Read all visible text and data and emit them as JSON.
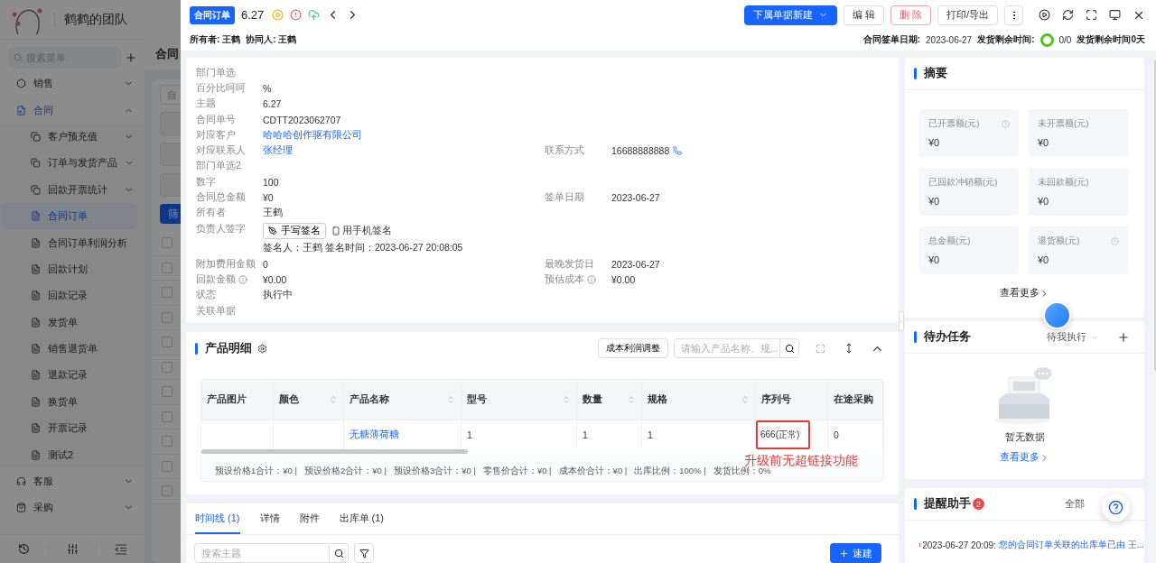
{
  "background_page": {
    "team_name": "鹤鹤的团队",
    "search": {
      "placeholder": "搜索菜单"
    },
    "menu": [
      {
        "label": "销售",
        "expanded": false
      },
      {
        "label": "合同",
        "expanded": true,
        "children": [
          {
            "label": "客户预充值",
            "kind": "group",
            "selected": false
          },
          {
            "label": "订单与发货产品",
            "kind": "group",
            "selected": false
          },
          {
            "label": "回款开票统计",
            "kind": "group",
            "selected": false
          },
          {
            "label": "合同订单",
            "kind": "page",
            "selected": true
          },
          {
            "label": "合同订单利润分析",
            "kind": "page",
            "selected": false
          },
          {
            "label": "回款计划",
            "kind": "page",
            "selected": false
          },
          {
            "label": "回款记录",
            "kind": "page",
            "selected": false
          },
          {
            "label": "发货单",
            "kind": "page",
            "selected": false
          },
          {
            "label": "销售退货单",
            "kind": "page",
            "selected": false
          },
          {
            "label": "退款记录",
            "kind": "page",
            "selected": false
          },
          {
            "label": "换货单",
            "kind": "page",
            "selected": false
          },
          {
            "label": "开票记录",
            "kind": "page",
            "selected": false
          },
          {
            "label": "测试2",
            "kind": "page",
            "selected": false
          }
        ]
      },
      {
        "label": "客服",
        "expanded": false
      },
      {
        "label": "采购",
        "expanded": false
      }
    ],
    "page_title": "合同",
    "filter_field": {
      "placeholder": "自"
    },
    "filter_button": "筛",
    "rows": [
      {
        "checked": false
      },
      {
        "checked": false
      },
      {
        "checked": false
      },
      {
        "checked": false
      },
      {
        "checked": false
      },
      {
        "checked": false
      },
      {
        "checked": false
      },
      {
        "checked": false
      },
      {
        "checked": false
      },
      {
        "checked": false
      },
      {
        "checked": false
      }
    ]
  },
  "drawer": {
    "header": {
      "tag": "合同订单",
      "title": "6.27",
      "owner": {
        "label": "所有者:",
        "value": "王鹤"
      },
      "collaborator": {
        "label": "协同人:",
        "value": "王鹤"
      },
      "actions": [
        {
          "label": "下属单据新建",
          "kind": "primary"
        },
        {
          "label": "编 辑",
          "kind": "default"
        },
        {
          "label": "删 除",
          "kind": "danger"
        },
        {
          "label": "打印/导出",
          "kind": "default"
        }
      ],
      "sign_date": {
        "label": "合同签单日期:",
        "value": "2023-06-27"
      },
      "delivery": {
        "label": "发货剩余时间:",
        "count": "0/0",
        "remaining": "发货剩余时间0天"
      }
    },
    "info": {
      "rows": [
        {
          "left": {
            "label": "部门单选",
            "info": false
          }
        },
        {
          "left": {
            "label": "百分比呵呵",
            "info": false,
            "value": "%",
            "kind": "text"
          }
        },
        {
          "left": {
            "label": "主题",
            "info": false,
            "value": "6.27",
            "kind": "text"
          }
        },
        {
          "left": {
            "label": "合同单号",
            "info": false,
            "value": "CDTT2023062707",
            "kind": "text"
          }
        },
        {
          "left": {
            "label": "对应客户",
            "info": false,
            "value": "哈哈哈创作驱有限公司",
            "kind": "link"
          }
        },
        {
          "left": {
            "label": "对应联系人",
            "info": false,
            "value": "张经理",
            "kind": "link"
          },
          "right": {
            "label": "联系方式",
            "info": false,
            "value": "16688888888",
            "kind": "phone"
          }
        },
        {
          "left": {
            "label": "部门单选2",
            "info": false
          }
        },
        {
          "left": {
            "label": "数字",
            "info": false,
            "value": "100",
            "kind": "text"
          }
        },
        {
          "left": {
            "label": "合同总金额",
            "info": false,
            "value": "¥0",
            "kind": "text"
          },
          "right": {
            "label": "签单日期",
            "info": false,
            "value": "2023-06-27",
            "kind": "text"
          }
        },
        {
          "left": {
            "label": "所有者",
            "info": false,
            "value": "王鹤",
            "kind": "text"
          }
        },
        {
          "left": {
            "label": "负责人签字",
            "info": false,
            "kind": "signature",
            "buttons": [
              "手写签名",
              "用手机签名"
            ],
            "value": "签名人：王鹤 签名时间：2023-06-27 20:08:05"
          }
        },
        {
          "left": {
            "label": "附加费用金额",
            "info": false,
            "value": "0",
            "kind": "text"
          },
          "right": {
            "label": "最晚发货日",
            "info": false,
            "value": "2023-06-27",
            "kind": "text"
          }
        },
        {
          "left": {
            "label": "回款金额",
            "info": true,
            "value": "¥0.00",
            "kind": "text"
          },
          "right": {
            "label": "预估成本",
            "info": true,
            "value": "¥0.00",
            "kind": "text"
          }
        },
        {
          "left": {
            "label": "状态",
            "info": false,
            "value": "执行中",
            "kind": "text"
          }
        },
        {
          "left": {
            "label": "关联单据",
            "info": false
          }
        }
      ]
    },
    "products": {
      "title": "产品明细",
      "adjust_button": "成本利润调整",
      "search": {
        "placeholder": "请输入产品名称、规..."
      },
      "columns": [
        {
          "label": "产品图片",
          "sortable": false
        },
        {
          "label": "颜色",
          "sortable": true
        },
        {
          "label": "产品名称",
          "sortable": true
        },
        {
          "label": "型号",
          "sortable": true
        },
        {
          "label": "数量",
          "sortable": true
        },
        {
          "label": "规格",
          "sortable": true
        },
        {
          "label": "序列号",
          "sortable": false
        },
        {
          "label": "在途采购",
          "sortable": false
        }
      ],
      "rows": [
        [
          {
            "kind": "empty"
          },
          {
            "kind": "empty"
          },
          {
            "text": "无糖薄荷糖",
            "kind": "link"
          },
          {
            "text": "1",
            "kind": "plain"
          },
          {
            "text": "1",
            "kind": "plain"
          },
          {
            "text": "1",
            "kind": "plain"
          },
          {
            "text": "666(正常)",
            "kind": "marked"
          },
          {
            "text": "0",
            "kind": "plain"
          }
        ]
      ],
      "totals": [
        "预设价格1合计：¥0 |",
        "预设价格2合计：¥0 |",
        "预设价格3合计：¥0 |",
        "零售价合计：¥0 |",
        "成本价合计：¥0 |",
        "出库比例：100% |",
        "发货比例：0%"
      ],
      "annotation": "升级前无超链接功能"
    },
    "timeline": {
      "tabs": [
        {
          "label": "时间线 (1)",
          "selected": true
        },
        {
          "label": "详情",
          "selected": false
        },
        {
          "label": "附件",
          "selected": false
        },
        {
          "label": "出库单 (1)",
          "selected": false
        }
      ],
      "search": {
        "placeholder": "搜索主题"
      },
      "quick_create": "速建"
    },
    "summary": {
      "title": "摘要",
      "stats": [
        {
          "label": "已开票额(元)",
          "value": "¥0",
          "clock": true
        },
        {
          "label": "未开票额(元)",
          "value": "¥0",
          "clock": false
        },
        {
          "label": "已回款冲销额(元)",
          "value": "¥0",
          "clock": false
        },
        {
          "label": "未回款额(元)",
          "value": "¥0",
          "clock": false
        },
        {
          "label": "总金额(元)",
          "value": "¥0",
          "clock": false
        },
        {
          "label": "退货额(元)",
          "value": "¥0",
          "clock": true
        }
      ],
      "more": "查看更多"
    },
    "todo": {
      "title": "待办任务",
      "filter": "待我执行",
      "empty": "暂无数据",
      "more": "查看更多"
    },
    "reminders": {
      "title": "提醒助手",
      "badge": "2",
      "filter": "全部",
      "items": [
        {
          "time": "2023-06-27 20:09:",
          "text": "您的合同订单关联的出库单已由 王..."
        }
      ]
    }
  }
}
